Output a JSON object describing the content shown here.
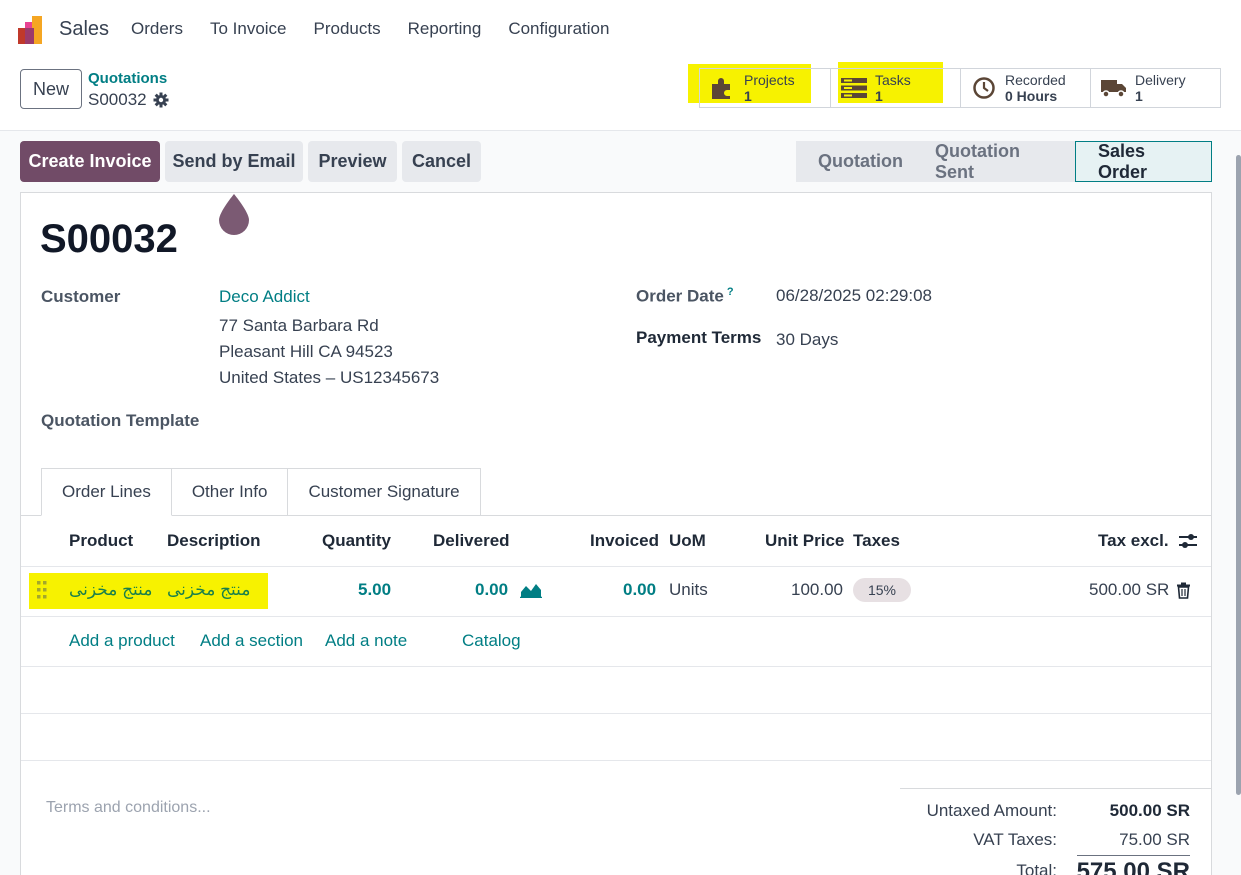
{
  "nav": {
    "app_name": "Sales",
    "menu": [
      "Orders",
      "To Invoice",
      "Products",
      "Reporting",
      "Configuration"
    ]
  },
  "control": {
    "new_label": "New",
    "breadcrumb_parent": "Quotations",
    "breadcrumb_current": "S00032"
  },
  "smart_buttons": {
    "projects": {
      "label": "Projects",
      "value": "1",
      "icon": "puzzle-icon"
    },
    "tasks": {
      "label": "Tasks",
      "value": "1",
      "icon": "tasks-icon"
    },
    "recorded": {
      "label": "Recorded",
      "value": "0 Hours",
      "icon": "clock-icon"
    },
    "delivery": {
      "label": "Delivery",
      "value": "1",
      "icon": "truck-icon"
    }
  },
  "actions": {
    "create_invoice": "Create Invoice",
    "send_email": "Send by Email",
    "preview": "Preview",
    "cancel": "Cancel"
  },
  "status": {
    "stages": [
      "Quotation",
      "Quotation Sent",
      "Sales Order"
    ],
    "active": "Sales Order"
  },
  "record": {
    "name": "S00032",
    "customer_label": "Customer",
    "customer_name": "Deco Addict",
    "address_line1": "77 Santa Barbara Rd",
    "address_line2": "Pleasant Hill CA 94523",
    "address_line3": "United States – US12345673",
    "order_date_label": "Order Date",
    "order_date_help": "?",
    "order_date": "06/28/2025 02:29:08",
    "payment_terms_label": "Payment Terms",
    "payment_terms": "30 Days",
    "quotation_template_label": "Quotation Template"
  },
  "tabs": [
    "Order Lines",
    "Other Info",
    "Customer Signature"
  ],
  "table": {
    "headers": {
      "product": "Product",
      "description": "Description",
      "quantity": "Quantity",
      "delivered": "Delivered",
      "invoiced": "Invoiced",
      "uom": "UoM",
      "unit_price": "Unit Price",
      "taxes": "Taxes",
      "tax_excl": "Tax excl."
    },
    "rows": [
      {
        "product": "منتج مخزنى",
        "description": "منتج مخزنى",
        "quantity": "5.00",
        "delivered": "0.00",
        "invoiced": "0.00",
        "uom": "Units",
        "unit_price": "100.00",
        "taxes": "15%",
        "tax_excl": "500.00 SR"
      }
    ],
    "add_product": "Add a product",
    "add_section": "Add a section",
    "add_note": "Add a note",
    "catalog": "Catalog"
  },
  "footer": {
    "terms_placeholder": "Terms and conditions...",
    "untaxed_label": "Untaxed Amount:",
    "untaxed_value": "500.00 SR",
    "vat_label": "VAT Taxes:",
    "vat_value": "75.00 SR",
    "total_label": "Total:",
    "total_value": "575.00 SR"
  },
  "colors": {
    "primary": "#714b67",
    "link": "#017e84",
    "highlight": "#f7f200"
  }
}
